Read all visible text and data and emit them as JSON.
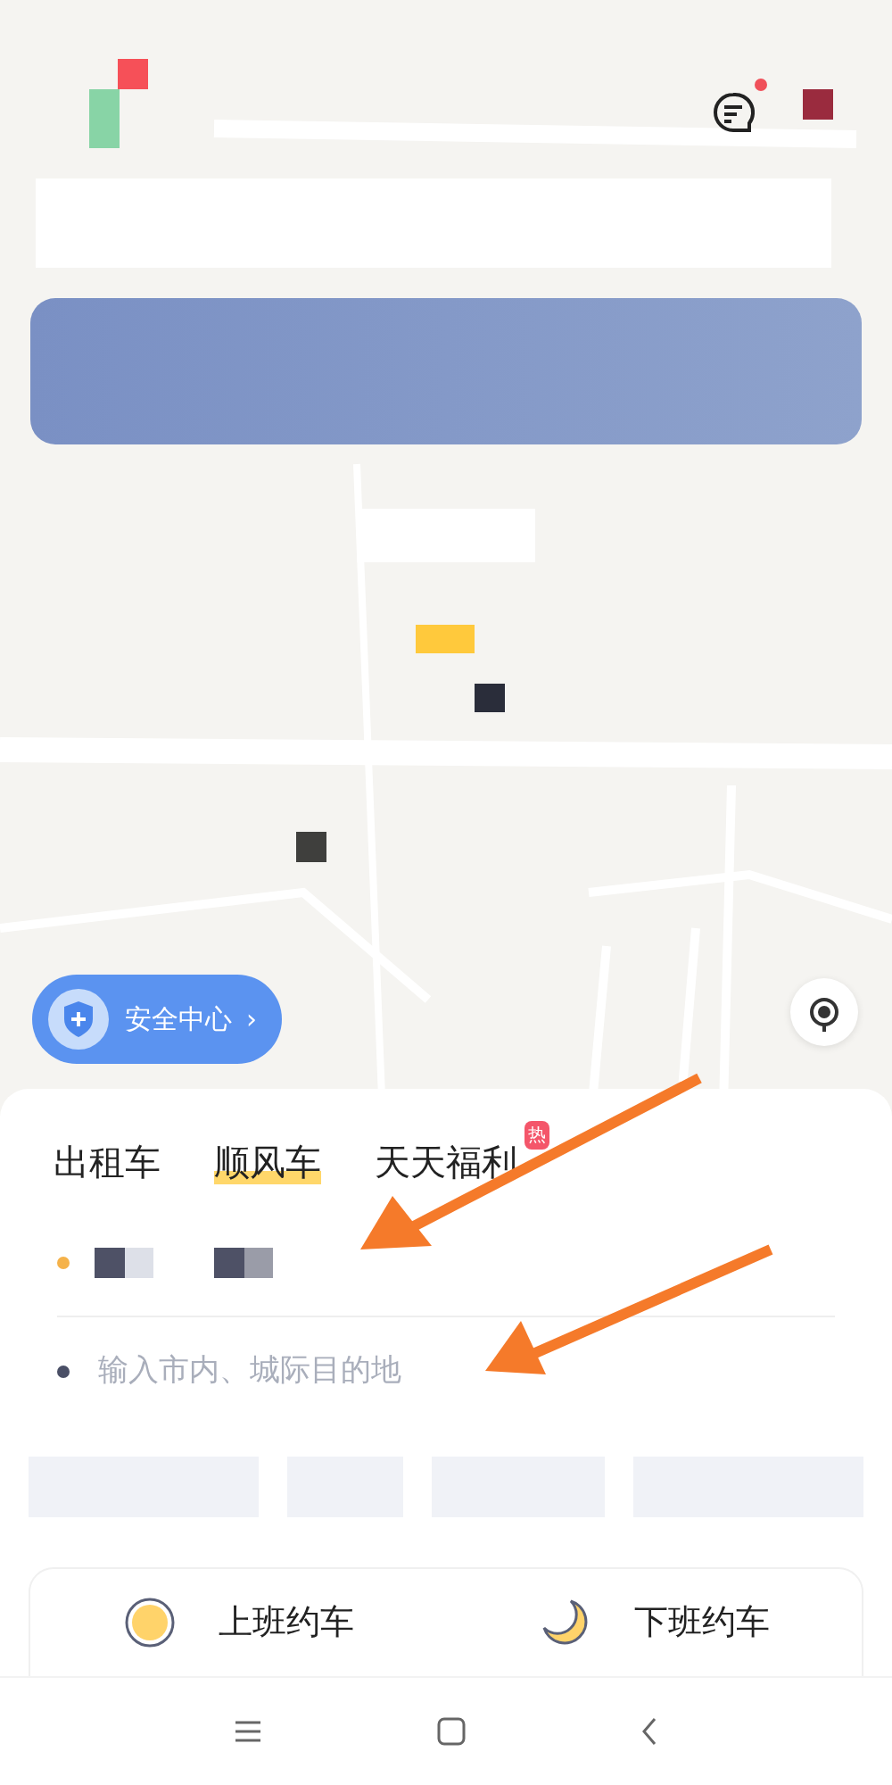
{
  "map": {
    "message_badge": true
  },
  "safety_button": {
    "label": "安全中心",
    "chevron": "›"
  },
  "tabs": [
    {
      "label": "出租车",
      "selected": false
    },
    {
      "label": "顺风车",
      "selected": true
    },
    {
      "label": "天天福利",
      "selected": false,
      "badge": "热"
    }
  ],
  "origin": {
    "color": "#f5b24a"
  },
  "destination": {
    "placeholder": "输入市内、城际目的地",
    "color": "#4a4f66"
  },
  "shortcuts": [
    {
      "name": "上班约车",
      "kind": "sun"
    },
    {
      "name": "下班约车",
      "kind": "moon"
    }
  ],
  "nav": [
    {
      "kind": "menu"
    },
    {
      "kind": "home"
    },
    {
      "kind": "back"
    }
  ]
}
